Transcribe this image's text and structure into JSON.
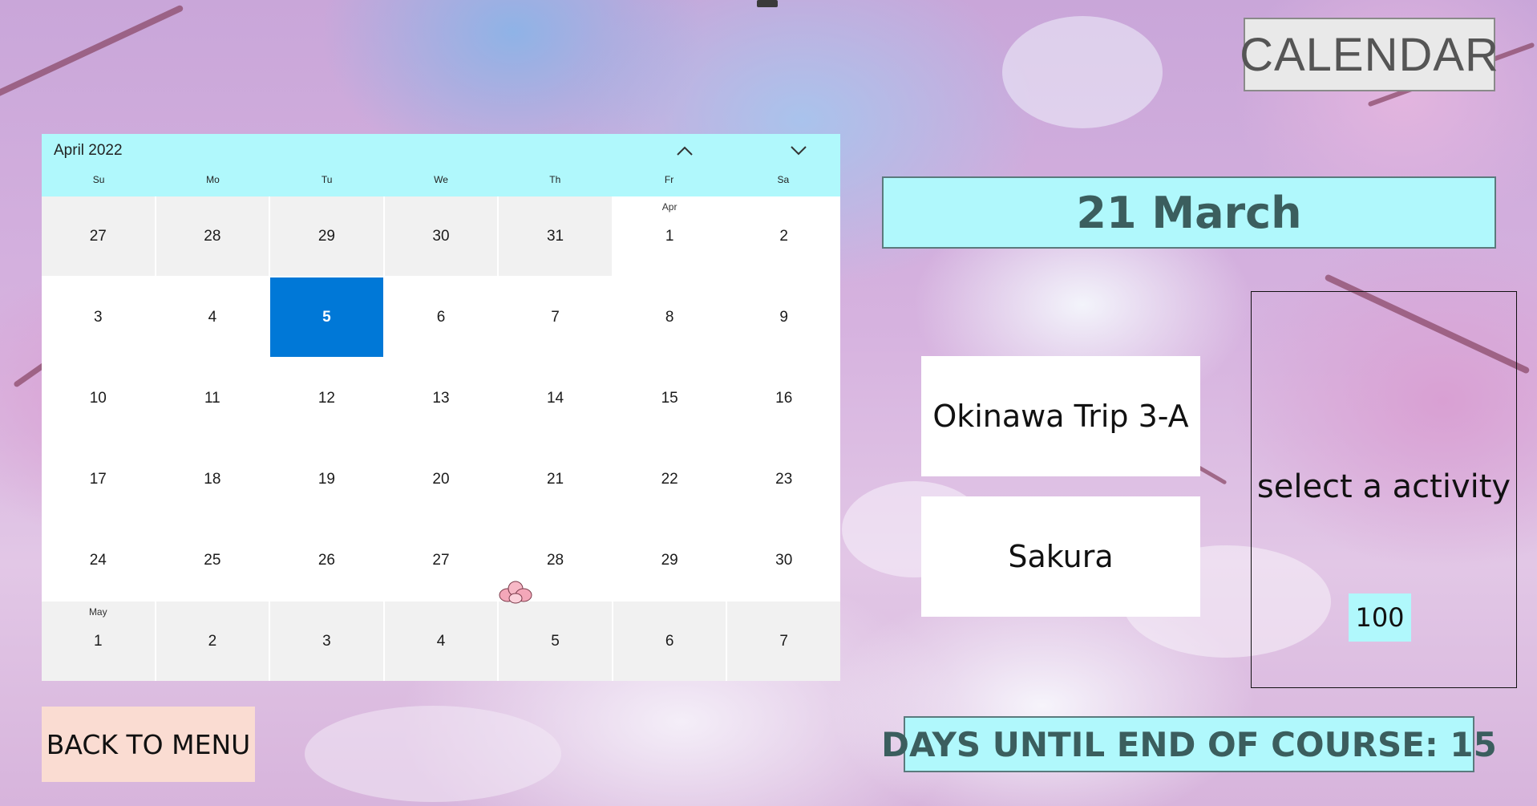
{
  "title_button": {
    "label": "CALENDAR"
  },
  "date_banner": {
    "text": "21 March"
  },
  "calendar": {
    "month_title": "April 2022",
    "weekdays": [
      "Su",
      "Mo",
      "Tu",
      "We",
      "Th",
      "Fr",
      "Sa"
    ],
    "days": [
      {
        "num": "27",
        "other": true
      },
      {
        "num": "28",
        "other": true
      },
      {
        "num": "29",
        "other": true
      },
      {
        "num": "30",
        "other": true
      },
      {
        "num": "31",
        "other": true
      },
      {
        "num": "1",
        "month_label": "Apr"
      },
      {
        "num": "2"
      },
      {
        "num": "3"
      },
      {
        "num": "4"
      },
      {
        "num": "5",
        "selected": true
      },
      {
        "num": "6"
      },
      {
        "num": "7"
      },
      {
        "num": "8"
      },
      {
        "num": "9"
      },
      {
        "num": "10"
      },
      {
        "num": "11"
      },
      {
        "num": "12"
      },
      {
        "num": "13"
      },
      {
        "num": "14"
      },
      {
        "num": "15"
      },
      {
        "num": "16"
      },
      {
        "num": "17"
      },
      {
        "num": "18"
      },
      {
        "num": "19"
      },
      {
        "num": "20"
      },
      {
        "num": "21"
      },
      {
        "num": "22"
      },
      {
        "num": "23"
      },
      {
        "num": "24"
      },
      {
        "num": "25"
      },
      {
        "num": "26"
      },
      {
        "num": "27"
      },
      {
        "num": "28"
      },
      {
        "num": "29"
      },
      {
        "num": "30"
      },
      {
        "num": "1",
        "other": true,
        "month_label": "May"
      },
      {
        "num": "2",
        "other": true
      },
      {
        "num": "3",
        "other": true
      },
      {
        "num": "4",
        "other": true
      },
      {
        "num": "5",
        "other": true
      },
      {
        "num": "6",
        "other": true
      },
      {
        "num": "7",
        "other": true
      }
    ],
    "colors": {
      "header": "#b0f8fc",
      "selected": "#0078d7",
      "other_month": "#f1f1f1"
    }
  },
  "events": [
    {
      "label": "Okinawa Trip 3-A"
    },
    {
      "label": "Sakura"
    }
  ],
  "activity": {
    "label": "select a activity",
    "value": "100"
  },
  "back_button": {
    "label": "BACK TO MENU"
  },
  "days_banner": {
    "text": "DAYS UNTIL END OF COURSE: 15"
  },
  "icons": {
    "prev": "chevron-up-icon",
    "next": "chevron-down-icon",
    "decor": "sakura-flower-icon"
  }
}
